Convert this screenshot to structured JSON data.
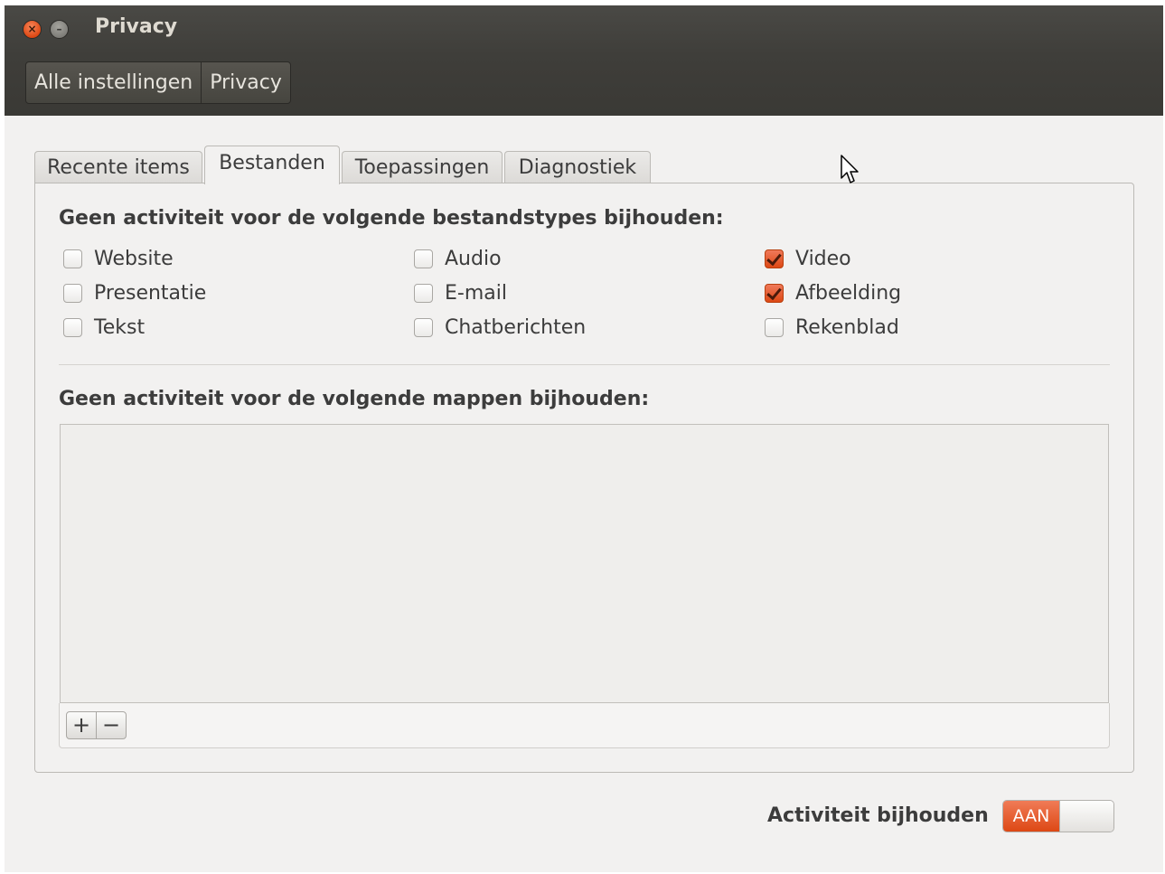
{
  "window": {
    "title": "Privacy",
    "close_glyph": "×",
    "minimize_glyph": "–"
  },
  "breadcrumb": [
    {
      "label": "Alle instellingen"
    },
    {
      "label": "Privacy"
    }
  ],
  "tabs": [
    {
      "label": "Recente items",
      "active": false
    },
    {
      "label": "Bestanden",
      "active": true
    },
    {
      "label": "Toepassingen",
      "active": false
    },
    {
      "label": "Diagnostiek",
      "active": false
    }
  ],
  "filetypes": {
    "heading": "Geen activiteit voor de volgende bestandstypes bijhouden:",
    "items": [
      {
        "label": "Website",
        "checked": false
      },
      {
        "label": "Audio",
        "checked": false
      },
      {
        "label": "Video",
        "checked": true
      },
      {
        "label": "Presentatie",
        "checked": false
      },
      {
        "label": "E-mail",
        "checked": false
      },
      {
        "label": "Afbeelding",
        "checked": true
      },
      {
        "label": "Tekst",
        "checked": false
      },
      {
        "label": "Chatberichten",
        "checked": false
      },
      {
        "label": "Rekenblad",
        "checked": false
      }
    ]
  },
  "folders": {
    "heading": "Geen activiteit voor de volgende mappen bijhouden:",
    "items": [],
    "add_glyph": "+",
    "remove_glyph": "−"
  },
  "activity": {
    "label": "Activiteit bijhouden",
    "switch_state": "AAN"
  },
  "colors": {
    "accent": "#dd4814",
    "titlebar": "#3f3e3a",
    "window_bg": "#f2f1f0"
  }
}
